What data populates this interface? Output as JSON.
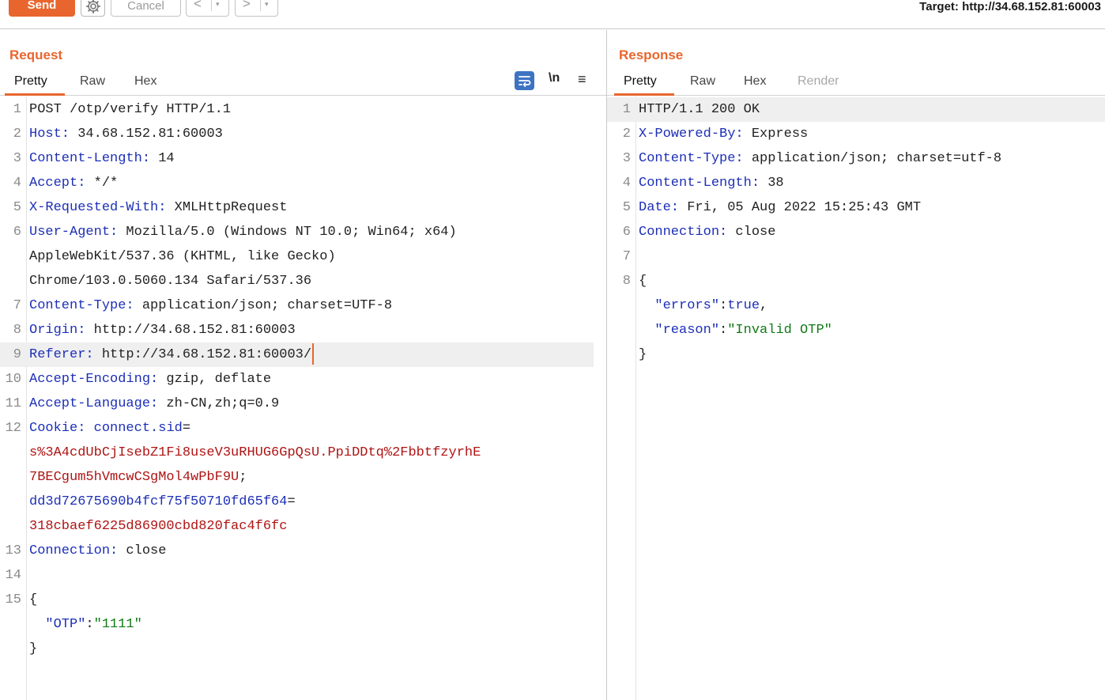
{
  "toolbar": {
    "send_label": "Send",
    "cancel_label": "Cancel",
    "back_label": "<",
    "forward_label": ">",
    "dropdown_glyph": "▾",
    "target_label": "Target: http://34.68.152.81:60003"
  },
  "colors": {
    "accent": "#e8662e",
    "header_key": "#1d2fb7",
    "cookie_value": "#b01414",
    "json_string": "#117a17",
    "tool_active": "#3e73c4"
  },
  "request": {
    "title": "Request",
    "tabs": [
      "Pretty",
      "Raw",
      "Hex"
    ],
    "active_tab": "Pretty",
    "tool_newline_label": "\\n",
    "tool_menu_glyph": "≡",
    "lines": [
      {
        "n": "1",
        "parts": [
          {
            "t": "POST /otp/verify HTTP/1.1",
            "c": "hv"
          }
        ]
      },
      {
        "n": "2",
        "parts": [
          {
            "t": "Host:",
            "c": "hk"
          },
          {
            "t": " 34.68.152.81:60003",
            "c": "hv"
          }
        ]
      },
      {
        "n": "3",
        "parts": [
          {
            "t": "Content-Length:",
            "c": "hk"
          },
          {
            "t": " 14",
            "c": "hv"
          }
        ]
      },
      {
        "n": "4",
        "parts": [
          {
            "t": "Accept:",
            "c": "hk"
          },
          {
            "t": " */*",
            "c": "hv"
          }
        ]
      },
      {
        "n": "5",
        "parts": [
          {
            "t": "X-Requested-With:",
            "c": "hk"
          },
          {
            "t": " XMLHttpRequest",
            "c": "hv"
          }
        ]
      },
      {
        "n": "6",
        "parts": [
          {
            "t": "User-Agent:",
            "c": "hk"
          },
          {
            "t": " Mozilla/5.0 (Windows NT 10.0; Win64; x64)",
            "c": "hv"
          }
        ]
      },
      {
        "n": "",
        "parts": [
          {
            "t": "AppleWebKit/537.36 (KHTML, like Gecko)",
            "c": "hv"
          }
        ]
      },
      {
        "n": "",
        "parts": [
          {
            "t": "Chrome/103.0.5060.134 Safari/537.36",
            "c": "hv"
          }
        ]
      },
      {
        "n": "7",
        "parts": [
          {
            "t": "Content-Type:",
            "c": "hk"
          },
          {
            "t": " application/json; charset=UTF-8",
            "c": "hv"
          }
        ]
      },
      {
        "n": "8",
        "parts": [
          {
            "t": "Origin:",
            "c": "hk"
          },
          {
            "t": " http://34.68.152.81:60003",
            "c": "hv"
          }
        ]
      },
      {
        "n": "9",
        "hl": true,
        "cursor": true,
        "parts": [
          {
            "t": "Referer:",
            "c": "hk"
          },
          {
            "t": " http://34.68.152.81:60003/",
            "c": "hv"
          }
        ]
      },
      {
        "n": "10",
        "parts": [
          {
            "t": "Accept-Encoding:",
            "c": "hk"
          },
          {
            "t": " gzip, deflate",
            "c": "hv"
          }
        ]
      },
      {
        "n": "11",
        "parts": [
          {
            "t": "Accept-Language:",
            "c": "hk"
          },
          {
            "t": " zh-CN,zh;q=0.9",
            "c": "hv"
          }
        ]
      },
      {
        "n": "12",
        "parts": [
          {
            "t": "Cookie:",
            "c": "hk"
          },
          {
            "t": " ",
            "c": "hv"
          },
          {
            "t": "connect.sid",
            "c": "ck"
          },
          {
            "t": "=",
            "c": "hv"
          }
        ]
      },
      {
        "n": "",
        "parts": [
          {
            "t": "s%3A4cdUbCjIsebZ1Fi8useV3uRHUG6GpQsU.PpiDDtq%2FbbtfzyrhE",
            "c": "cv"
          }
        ]
      },
      {
        "n": "",
        "parts": [
          {
            "t": "7BECgum5hVmcwCSgMol4wPbF9U",
            "c": "cv"
          },
          {
            "t": ";",
            "c": "hv"
          }
        ]
      },
      {
        "n": "",
        "parts": [
          {
            "t": "dd3d72675690b4fcf75f50710fd65f64",
            "c": "ck"
          },
          {
            "t": "=",
            "c": "hv"
          }
        ]
      },
      {
        "n": "",
        "parts": [
          {
            "t": "318cbaef6225d86900cbd820fac4f6fc",
            "c": "cv"
          }
        ]
      },
      {
        "n": "13",
        "parts": [
          {
            "t": "Connection:",
            "c": "hk"
          },
          {
            "t": " close",
            "c": "hv"
          }
        ]
      },
      {
        "n": "14",
        "parts": []
      },
      {
        "n": "15",
        "parts": [
          {
            "t": "{",
            "c": "jp"
          }
        ]
      },
      {
        "n": "",
        "parts": [
          {
            "t": "  ",
            "c": "jp"
          },
          {
            "t": "\"OTP\"",
            "c": "jk"
          },
          {
            "t": ":",
            "c": "jp"
          },
          {
            "t": "\"1111\"",
            "c": "js"
          }
        ]
      },
      {
        "n": "",
        "parts": [
          {
            "t": "}",
            "c": "jp"
          }
        ]
      }
    ]
  },
  "response": {
    "title": "Response",
    "tabs": [
      "Pretty",
      "Raw",
      "Hex",
      "Render"
    ],
    "active_tab": "Pretty",
    "disabled_tab": "Render",
    "lines": [
      {
        "n": "1",
        "hl": true,
        "parts": [
          {
            "t": "HTTP/1.1 200 OK",
            "c": "hv"
          }
        ]
      },
      {
        "n": "2",
        "parts": [
          {
            "t": "X-Powered-By:",
            "c": "hk"
          },
          {
            "t": " Express",
            "c": "hv"
          }
        ]
      },
      {
        "n": "3",
        "parts": [
          {
            "t": "Content-Type:",
            "c": "hk"
          },
          {
            "t": " application/json; charset=utf-8",
            "c": "hv"
          }
        ]
      },
      {
        "n": "4",
        "parts": [
          {
            "t": "Content-Length:",
            "c": "hk"
          },
          {
            "t": " 38",
            "c": "hv"
          }
        ]
      },
      {
        "n": "5",
        "parts": [
          {
            "t": "Date:",
            "c": "hk"
          },
          {
            "t": " Fri, 05 Aug 2022 15:25:43 GMT",
            "c": "hv"
          }
        ]
      },
      {
        "n": "6",
        "parts": [
          {
            "t": "Connection:",
            "c": "hk"
          },
          {
            "t": " close",
            "c": "hv"
          }
        ]
      },
      {
        "n": "7",
        "parts": []
      },
      {
        "n": "8",
        "parts": [
          {
            "t": "{",
            "c": "jp"
          }
        ]
      },
      {
        "n": "",
        "parts": [
          {
            "t": "  ",
            "c": "jp"
          },
          {
            "t": "\"errors\"",
            "c": "jk"
          },
          {
            "t": ":",
            "c": "jp"
          },
          {
            "t": "true",
            "c": "jk"
          },
          {
            "t": ",",
            "c": "jp"
          }
        ]
      },
      {
        "n": "",
        "parts": [
          {
            "t": "  ",
            "c": "jp"
          },
          {
            "t": "\"reason\"",
            "c": "jk"
          },
          {
            "t": ":",
            "c": "jp"
          },
          {
            "t": "\"Invalid OTP\"",
            "c": "js"
          }
        ]
      },
      {
        "n": "",
        "parts": [
          {
            "t": "}",
            "c": "jp"
          }
        ]
      }
    ]
  }
}
